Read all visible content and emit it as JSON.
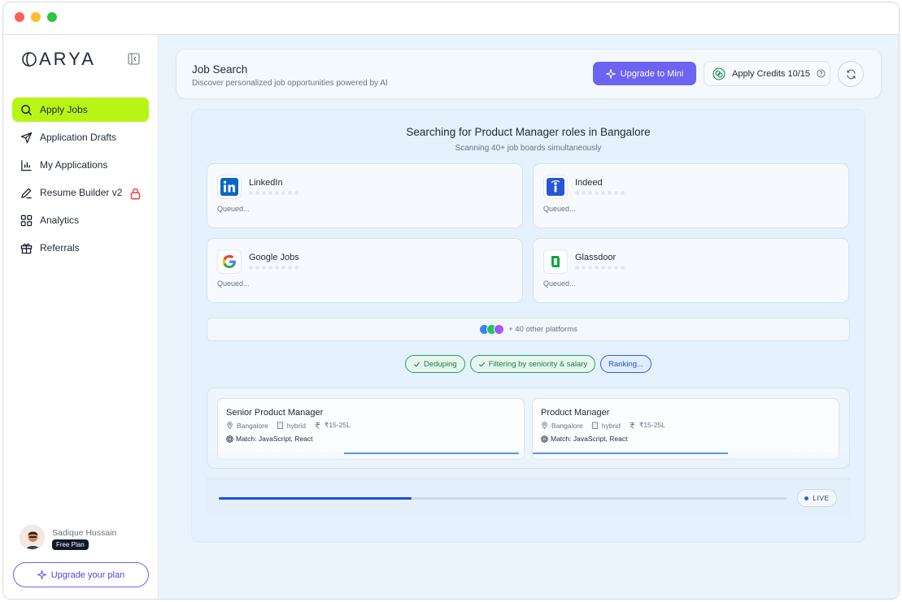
{
  "app": {
    "brand": "ARYA"
  },
  "sidebar": {
    "items": [
      {
        "label": "Apply Jobs",
        "icon": "search-icon",
        "active": true
      },
      {
        "label": "Application Drafts",
        "icon": "send-icon"
      },
      {
        "label": "My Applications",
        "icon": "bar-chart-icon"
      },
      {
        "label": "Resume Builder v2",
        "icon": "pen-icon",
        "locked": true
      },
      {
        "label": "Analytics",
        "icon": "grid-icon"
      },
      {
        "label": "Referrals",
        "icon": "gift-icon"
      }
    ],
    "user": {
      "name": "Sadique Hussain",
      "plan": "Free Plan"
    },
    "upgrade_label": "Upgrade your plan"
  },
  "header": {
    "title": "Job Search",
    "subtitle": "Discover personalized job opportunities powered by AI",
    "upgrade_button": "Upgrade to Mini",
    "credits_label": "Apply Credits 10/15"
  },
  "search": {
    "title": "Searching for Product Manager roles in Bangalore",
    "subtitle": "Scanning 40+ job boards simultaneously",
    "boards": [
      {
        "name": "LinkedIn",
        "status": "Queued...",
        "icon": "linkedin-icon"
      },
      {
        "name": "Indeed",
        "status": "Queued...",
        "icon": "indeed-icon"
      },
      {
        "name": "Google Jobs",
        "status": "Queued...",
        "icon": "google-icon"
      },
      {
        "name": "Glassdoor",
        "status": "Queued...",
        "icon": "glassdoor-icon"
      }
    ],
    "other_platforms": "+ 40 other platforms",
    "steps": [
      {
        "label": "Deduping",
        "state": "done"
      },
      {
        "label": "Filtering by seniority & salary",
        "state": "done"
      },
      {
        "label": "Ranking...",
        "state": "active"
      }
    ],
    "jobs": [
      {
        "title": "Senior Product Manager",
        "location": "Bangalore",
        "mode": "hybrid",
        "salary": "₹15-25L",
        "match": "Match: JavaScript, React"
      },
      {
        "title": "Product Manager",
        "location": "Bangalore",
        "mode": "hybrid",
        "salary": "₹15-25L",
        "match": "Match: JavaScript, React"
      }
    ],
    "progress": 0.34,
    "live_label": "LIVE"
  },
  "colors": {
    "accent_lime": "#b8f516",
    "primary_purple": "#6c63f2",
    "progress_blue": "#1d4ed8",
    "success_green": "#22a05a"
  }
}
